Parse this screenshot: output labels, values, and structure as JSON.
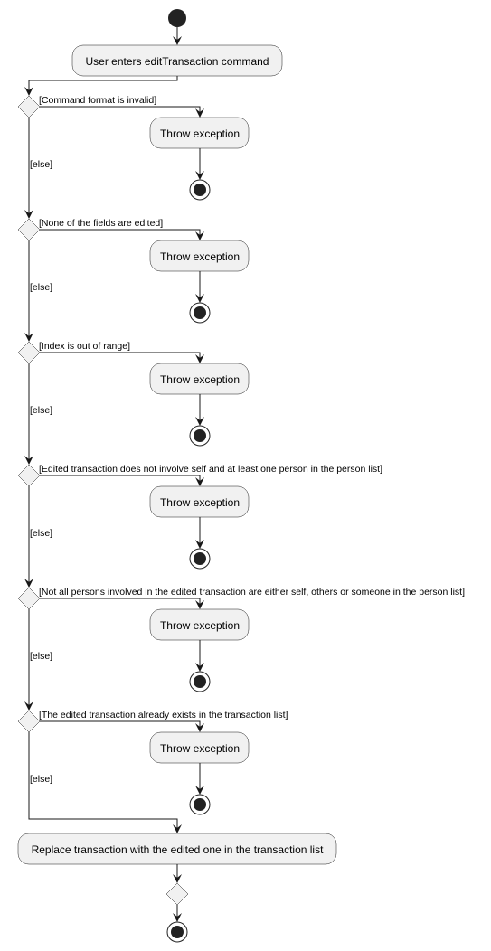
{
  "diagram": {
    "type": "UML activity diagram",
    "start_action": "User enters editTransaction command",
    "decisions": [
      {
        "guard": "[Command format is invalid]",
        "action": "Throw exception",
        "else_label": "[else]"
      },
      {
        "guard": "[None of the fields are edited]",
        "action": "Throw exception",
        "else_label": "[else]"
      },
      {
        "guard": "[Index is out of range]",
        "action": "Throw exception",
        "else_label": "[else]"
      },
      {
        "guard": "[Edited transaction does not involve self and at least one person in the person list]",
        "action": "Throw exception",
        "else_label": "[else]"
      },
      {
        "guard": "[Not all persons involved in the edited transaction are either self, others or someone in the person list]",
        "action": "Throw exception",
        "else_label": "[else]"
      },
      {
        "guard": "[The edited transaction already exists in the transaction list]",
        "action": "Throw exception",
        "else_label": "[else]"
      }
    ],
    "final_action": "Replace transaction with the edited one in the transaction list",
    "colors": {
      "node_fill": "#f1f1f1",
      "node_stroke": "#181818",
      "line": "#181818",
      "terminal": "#222222",
      "background": "#ffffff"
    }
  }
}
